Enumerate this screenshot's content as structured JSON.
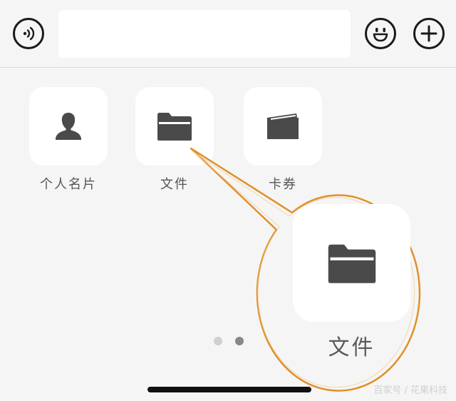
{
  "colors": {
    "background": "#f5f5f5",
    "tile": "#ffffff",
    "icon": "#4a4a4a",
    "callout_border": "#e0902a",
    "dot_active": "#888888",
    "dot_inactive": "#cfcfcf"
  },
  "input_bar": {
    "voice_icon": "voice-icon",
    "text_value": "",
    "emoji_icon": "emoji-icon",
    "add_icon": "plus-icon"
  },
  "panel": {
    "items": [
      {
        "label": "个人名片",
        "icon": "person-icon"
      },
      {
        "label": "文件",
        "icon": "folder-icon"
      },
      {
        "label": "卡券",
        "icon": "wallet-icon"
      }
    ]
  },
  "pagination": {
    "total": 2,
    "active": 2
  },
  "callout": {
    "label": "文件",
    "icon": "folder-icon"
  },
  "watermark": "百家号 / 花果科技"
}
